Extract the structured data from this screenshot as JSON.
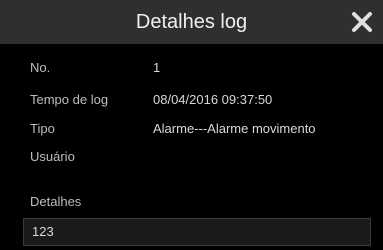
{
  "dialog": {
    "title": "Detalhes log",
    "close_icon": "close-icon"
  },
  "fields": [
    {
      "label": "No.",
      "value": "1"
    },
    {
      "label": "Tempo de log",
      "value": "08/04/2016 09:37:50"
    },
    {
      "label": "Tipo",
      "value": "Alarme---Alarme movimento"
    },
    {
      "label": "Usuário",
      "value": ""
    }
  ],
  "details": {
    "label": "Detalhes",
    "value": "123"
  },
  "colors": {
    "header_bg": "#2f2f2f",
    "body_bg": "#000000",
    "text": "#d8d8d8",
    "label": "#bdbdbd"
  }
}
